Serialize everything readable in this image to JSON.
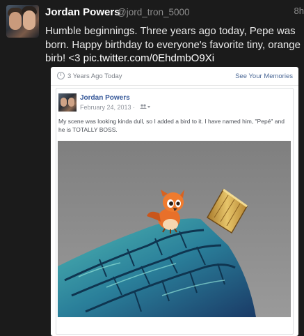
{
  "tweet": {
    "author_name": "Jordan Powers",
    "author_handle": "@jord_tron_5000",
    "time": "8h",
    "text": "Humble beginnings. Three years ago today, Pepe was born. Happy birthday to everyone's favorite tiny, orange birb! <3 ",
    "link": "pic.twitter.com/0EhdmbO9Xi"
  },
  "memory_card": {
    "header_title": "3 Years Ago Today",
    "see_memories": "See Your Memories",
    "post": {
      "author": "Jordan Powers",
      "date": "February 24, 2013 ·",
      "audience_icon": "friends-icon",
      "body": "My scene was looking kinda dull, so I added a bird to it. I have named him, \"Pepé\" and he is TOTALLY BOSS."
    }
  },
  "colors": {
    "background": "#1b1b1b",
    "link_blue": "#365899",
    "bird_orange": "#e8702a"
  }
}
